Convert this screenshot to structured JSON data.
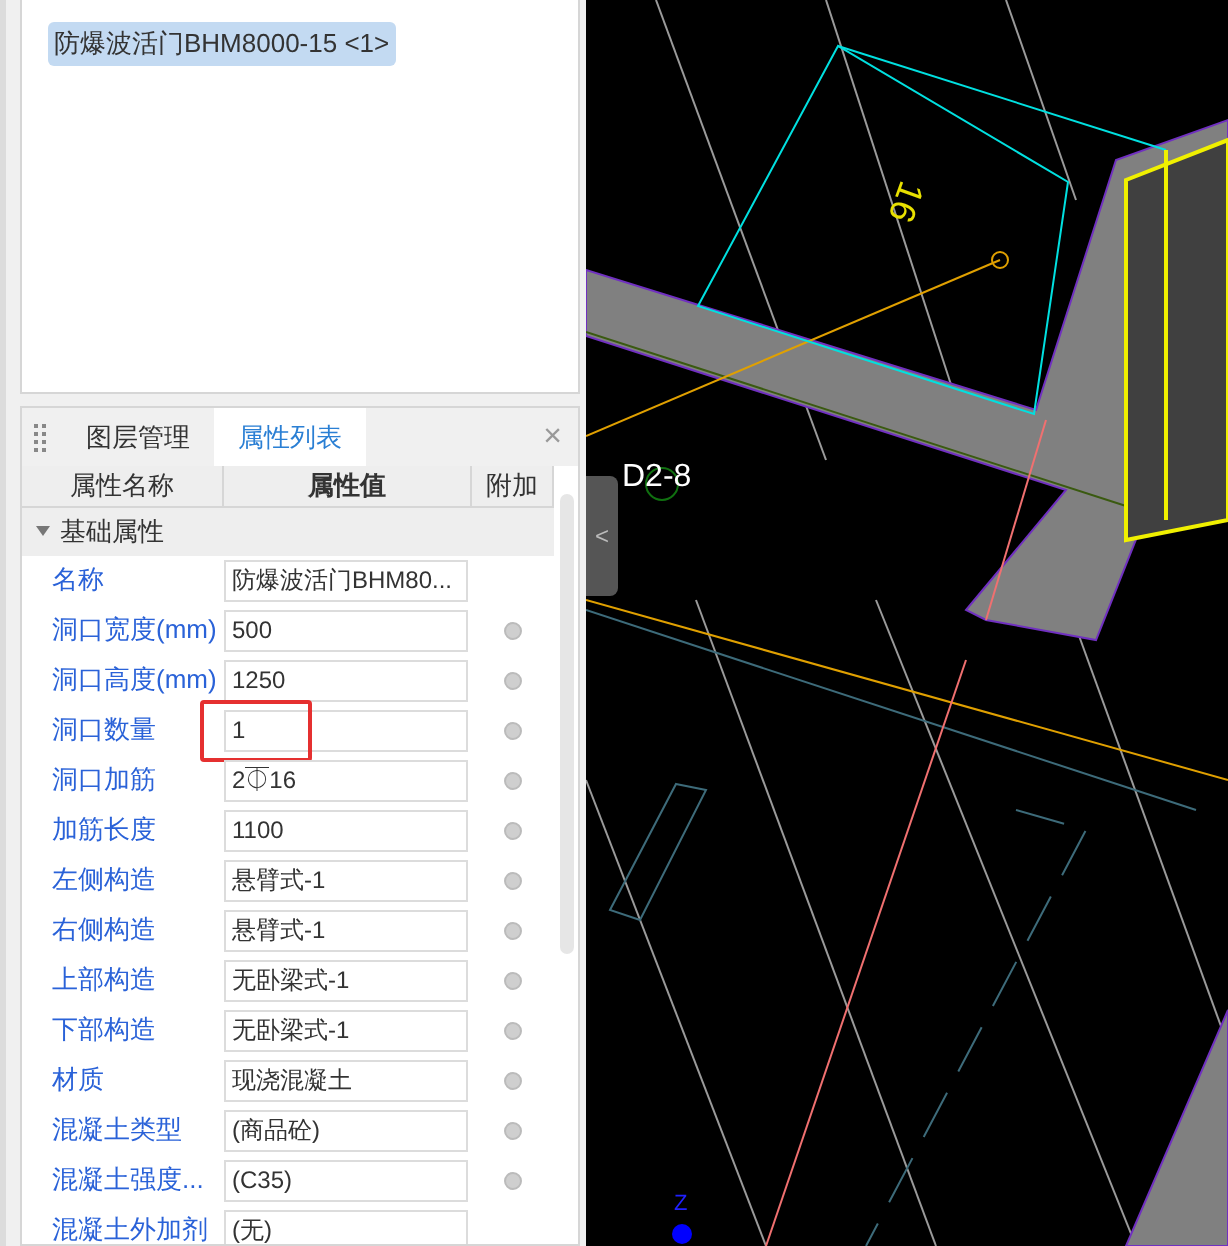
{
  "component_list": {
    "items": [
      {
        "label": "防爆波活门BHM8000-15 <1>",
        "selected": true
      }
    ]
  },
  "panel": {
    "tabs": [
      {
        "label": "图层管理",
        "selected": false
      },
      {
        "label": "属性列表",
        "selected": true
      }
    ],
    "close": "×",
    "columns": [
      "属性名称",
      "属性值",
      "附加"
    ],
    "group": {
      "label": "基础属性",
      "expanded": true
    },
    "rows": [
      {
        "name": "名称",
        "value": "防爆波活门BHM80...",
        "extra": false,
        "highlighted": false
      },
      {
        "name": "洞口宽度(mm)",
        "value": "500",
        "extra": true,
        "highlighted": false
      },
      {
        "name": "洞口高度(mm)",
        "value": "1250",
        "extra": true,
        "highlighted": false
      },
      {
        "name": "洞口数量",
        "value": "1",
        "extra": true,
        "highlighted": true
      },
      {
        "name": "洞口加筋",
        "value": "2⏁16",
        "extra": true,
        "highlighted": false
      },
      {
        "name": "加筋长度",
        "value": "1100",
        "extra": true,
        "highlighted": false
      },
      {
        "name": "左侧构造",
        "value": "悬臂式-1",
        "extra": true,
        "highlighted": false
      },
      {
        "name": "右侧构造",
        "value": "悬臂式-1",
        "extra": true,
        "highlighted": false
      },
      {
        "name": "上部构造",
        "value": "无卧梁式-1",
        "extra": true,
        "highlighted": false
      },
      {
        "name": "下部构造",
        "value": "无卧梁式-1",
        "extra": true,
        "highlighted": false
      },
      {
        "name": "材质",
        "value": "现浇混凝土",
        "extra": true,
        "highlighted": false
      },
      {
        "name": "混凝土类型",
        "value": "(商品砼)",
        "extra": true,
        "highlighted": false
      },
      {
        "name": "混凝土强度...",
        "value": "(C35)",
        "extra": true,
        "highlighted": false
      },
      {
        "name": "混凝土外加剂",
        "value": "(无)",
        "extra": false,
        "highlighted": false
      }
    ]
  },
  "canvas": {
    "labels": [
      {
        "text": "D2-8",
        "kind": "axis"
      },
      {
        "text": "16",
        "kind": "rebar"
      },
      {
        "text": "Z",
        "kind": "ucs"
      }
    ],
    "collapse": "<"
  }
}
